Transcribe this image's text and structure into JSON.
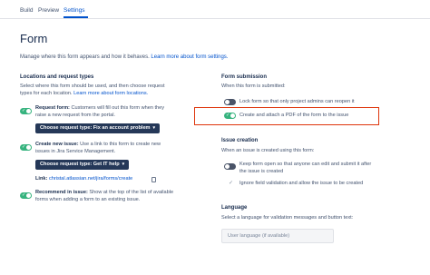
{
  "tabs": [
    "Build",
    "Preview",
    "Settings"
  ],
  "page": {
    "title": "Form",
    "desc_text": "Manage where this form appears and how it behaves.",
    "desc_link": "Learn more about form settings."
  },
  "locations": {
    "title": "Locations and request types",
    "desc_line1": "Select where this form should be used, and then choose request",
    "desc_line2": "types for each location.",
    "desc_link": "Learn more about form locations.",
    "request_form": {
      "label": "Request form:",
      "line1": "Customers will fill out this form when they",
      "line2": "raise a new request from the portal.",
      "button": "Choose request type: Fix an account problem"
    },
    "create_issue": {
      "label": "Create new issue:",
      "line1": "Use a link to this form to create new",
      "line2": "issues in Jira Service Management.",
      "button": "Choose request type: Get IT help",
      "link_label": "Link:",
      "link_url": "christal.atlassian.net/jira/forms/create"
    },
    "recommended": {
      "label": "Recommend in issue:",
      "line1": "Show at the top of the list of available",
      "line2": "forms when adding a form to an existing issue."
    }
  },
  "submission": {
    "title": "Form submission",
    "subtitle": "When this form is submitted:",
    "lock": "Lock form so that only project admins can reopen it",
    "pdf": "Create and attach a PDF of the form to the issue"
  },
  "issue_creation": {
    "title": "Issue creation",
    "subtitle": "When an issue is created using this form:",
    "keep_line1": "Keep form open so that anyone can edit and submit it after",
    "keep_line2": "the issue is created",
    "ignore": "Ignore field validation and allow the issue to be created"
  },
  "language": {
    "title": "Language",
    "subtitle": "Select a language for validation messages and button text:",
    "select_value": "User language (if available)"
  },
  "colors": {
    "accent": "#0052cc",
    "toggle_on": "#36b37e",
    "toggle_off": "#4a5468",
    "highlight": "#de350b",
    "dark_button": "#253858"
  },
  "icons": {
    "toggle_check": "✓",
    "chevron": "▾",
    "ignore_check": "✓"
  }
}
